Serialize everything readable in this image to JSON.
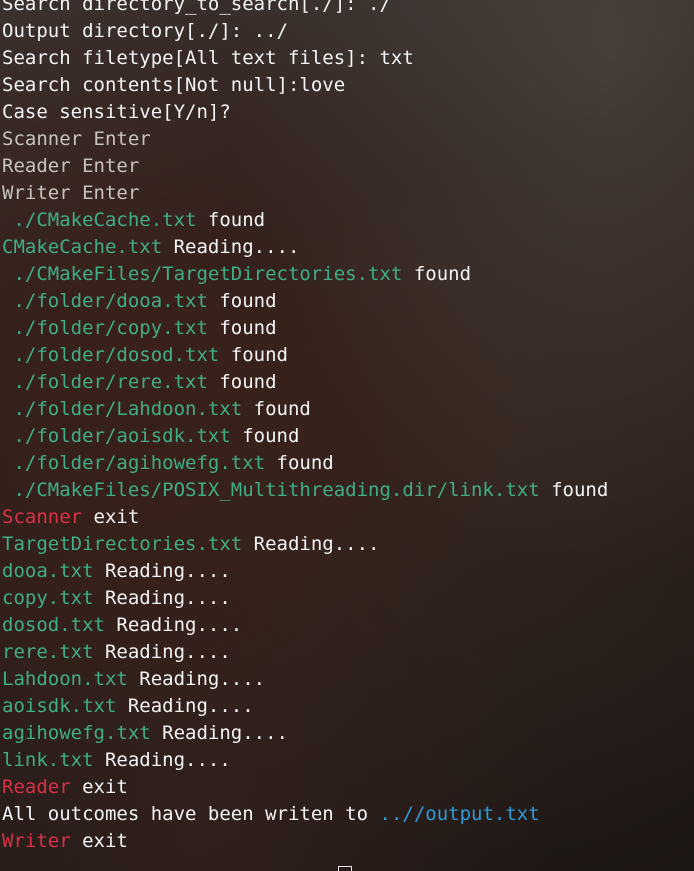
{
  "window": {
    "app": "terminal"
  },
  "colors": {
    "prompt_text": "#f4f4f4",
    "dim_text": "#c9c3bd",
    "path_green": "#3fae84",
    "exit_red": "#d9304a",
    "output_blue": "#2e9ad6"
  },
  "terminal": {
    "lines": [
      [
        {
          "t": "Search directory_to_search[./]: ./",
          "c": "white"
        }
      ],
      [
        {
          "t": "Output directory[./]: ../",
          "c": "white"
        }
      ],
      [
        {
          "t": "Search filetype[All text files]: txt",
          "c": "white"
        }
      ],
      [
        {
          "t": "Search contents[Not null]:love",
          "c": "white"
        }
      ],
      [
        {
          "t": "Case sensitive[Y/n]?",
          "c": "white"
        }
      ],
      [
        {
          "t": "Scanner Enter",
          "c": "dim"
        }
      ],
      [
        {
          "t": "Reader Enter",
          "c": "dim"
        }
      ],
      [
        {
          "t": "Writer Enter",
          "c": "dim"
        }
      ],
      [
        {
          "t": " ./CMakeCache.txt",
          "c": "green"
        },
        {
          "t": " found",
          "c": "white"
        }
      ],
      [
        {
          "t": "CMakeCache.txt",
          "c": "green"
        },
        {
          "t": " Reading....",
          "c": "white"
        }
      ],
      [
        {
          "t": " ./CMakeFiles/TargetDirectories.txt",
          "c": "green"
        },
        {
          "t": " found",
          "c": "white"
        }
      ],
      [
        {
          "t": " ./folder/dooa.txt",
          "c": "green"
        },
        {
          "t": " found",
          "c": "white"
        }
      ],
      [
        {
          "t": " ./folder/copy.txt",
          "c": "green"
        },
        {
          "t": " found",
          "c": "white"
        }
      ],
      [
        {
          "t": " ./folder/dosod.txt",
          "c": "green"
        },
        {
          "t": " found",
          "c": "white"
        }
      ],
      [
        {
          "t": " ./folder/rere.txt",
          "c": "green"
        },
        {
          "t": " found",
          "c": "white"
        }
      ],
      [
        {
          "t": " ./folder/Lahdoon.txt",
          "c": "green"
        },
        {
          "t": " found",
          "c": "white"
        }
      ],
      [
        {
          "t": " ./folder/aoisdk.txt",
          "c": "green"
        },
        {
          "t": " found",
          "c": "white"
        }
      ],
      [
        {
          "t": " ./folder/agihowefg.txt",
          "c": "green"
        },
        {
          "t": " found",
          "c": "white"
        }
      ],
      [
        {
          "t": " ./CMakeFiles/POSIX_Multithreading.dir/link.txt",
          "c": "green"
        },
        {
          "t": " found",
          "c": "white"
        }
      ],
      [
        {
          "t": "Scanner",
          "c": "red"
        },
        {
          "t": " exit",
          "c": "white"
        }
      ],
      [
        {
          "t": "TargetDirectories.txt",
          "c": "green"
        },
        {
          "t": " Reading....",
          "c": "white"
        }
      ],
      [
        {
          "t": "dooa.txt",
          "c": "green"
        },
        {
          "t": " Reading....",
          "c": "white"
        }
      ],
      [
        {
          "t": "copy.txt",
          "c": "green"
        },
        {
          "t": " Reading....",
          "c": "white"
        }
      ],
      [
        {
          "t": "dosod.txt",
          "c": "green"
        },
        {
          "t": " Reading....",
          "c": "white"
        }
      ],
      [
        {
          "t": "rere.txt",
          "c": "green"
        },
        {
          "t": " Reading....",
          "c": "white"
        }
      ],
      [
        {
          "t": "Lahdoon.txt",
          "c": "green"
        },
        {
          "t": " Reading....",
          "c": "white"
        }
      ],
      [
        {
          "t": "aoisdk.txt",
          "c": "green"
        },
        {
          "t": " Reading....",
          "c": "white"
        }
      ],
      [
        {
          "t": "agihowefg.txt",
          "c": "green"
        },
        {
          "t": " Reading....",
          "c": "white"
        }
      ],
      [
        {
          "t": "link.txt",
          "c": "green"
        },
        {
          "t": " Reading....",
          "c": "white"
        }
      ],
      [
        {
          "t": "Reader",
          "c": "red"
        },
        {
          "t": " exit",
          "c": "white"
        }
      ],
      [
        {
          "t": "All outcomes have been writen to ",
          "c": "white"
        },
        {
          "t": "..//output.txt",
          "c": "blue"
        }
      ],
      [
        {
          "t": "Writer",
          "c": "red"
        },
        {
          "t": " exit",
          "c": "white"
        }
      ]
    ]
  }
}
